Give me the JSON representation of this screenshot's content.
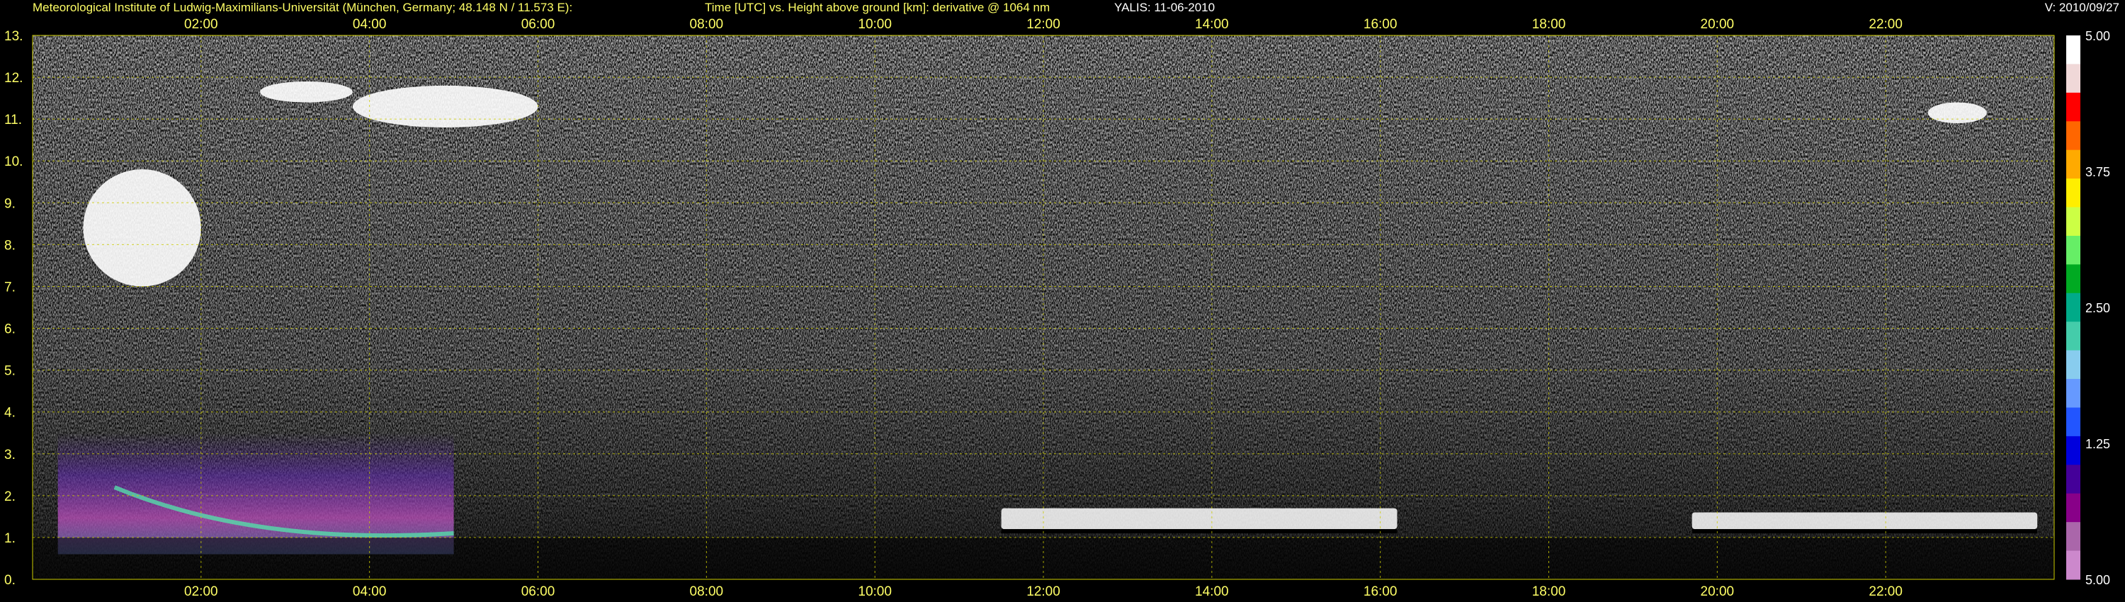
{
  "header": {
    "institute": "Meteorological Institute of Ludwig-Maximilians-Universität (München, Germany; 48.148 N / 11.573 E):",
    "title": "Time [UTC] vs. Height above ground [km]: derivative @ 1064 nm",
    "instrument": "YALIS: 11-06-2010",
    "version": "V: 2010/09/27"
  },
  "chart_data": {
    "type": "heatmap",
    "title": "Time [UTC] vs. Height above ground [km]: derivative @ 1064 nm",
    "xlabel": "Time [UTC]",
    "ylabel": "Height above ground [km]",
    "x_ticks": [
      "02:00",
      "04:00",
      "06:00",
      "08:00",
      "10:00",
      "12:00",
      "14:00",
      "16:00",
      "18:00",
      "20:00",
      "22:00"
    ],
    "x_tick_hours": [
      2,
      4,
      6,
      8,
      10,
      12,
      14,
      16,
      18,
      20,
      22
    ],
    "xlim_hours": [
      0,
      24
    ],
    "y_ticks": [
      "0.",
      "1.",
      "2.",
      "3.",
      "4.",
      "5.",
      "6.",
      "7.",
      "8.",
      "9.",
      "10.",
      "11.",
      "12.",
      "13."
    ],
    "ylim_km": [
      0,
      13
    ],
    "grid": true,
    "grid_color": "#cccc00",
    "colorbar": {
      "labels": [
        "5.00",
        "3.75",
        "2.50",
        "1.25",
        "5.00"
      ],
      "colors_top_to_bottom": [
        "#ffffff",
        "#f0d8d8",
        "#ff0000",
        "#ff6600",
        "#ffaa00",
        "#ffee00",
        "#ccff44",
        "#66ee66",
        "#00aa22",
        "#00aa88",
        "#44ccaa",
        "#88ccee",
        "#6699ff",
        "#2255ff",
        "#0000dd",
        "#440099",
        "#880088",
        "#aa66aa",
        "#cc88cc"
      ]
    },
    "features": [
      {
        "name": "cirrus",
        "t_start": 0.6,
        "t_end": 2.0,
        "h_low": 7.0,
        "h_high": 9.8
      },
      {
        "name": "cirrus",
        "t_start": 2.7,
        "t_end": 3.8,
        "h_low": 11.4,
        "h_high": 11.9
      },
      {
        "name": "cirrus",
        "t_start": 3.8,
        "t_end": 6.0,
        "h_low": 10.8,
        "h_high": 11.8
      },
      {
        "name": "cirrus",
        "t_start": 22.5,
        "t_end": 23.2,
        "h_low": 10.9,
        "h_high": 11.4
      },
      {
        "name": "aerosol-layer",
        "t_start": 0.3,
        "t_end": 5.0,
        "h_low": 0.6,
        "h_high": 3.5
      },
      {
        "name": "boundary-layer-clouds",
        "t_start": 11.5,
        "t_end": 16.2,
        "h_low": 1.2,
        "h_high": 1.7
      },
      {
        "name": "cloud-layer",
        "t_start": 19.7,
        "t_end": 23.8,
        "h_low": 1.2,
        "h_high": 1.6
      }
    ]
  }
}
